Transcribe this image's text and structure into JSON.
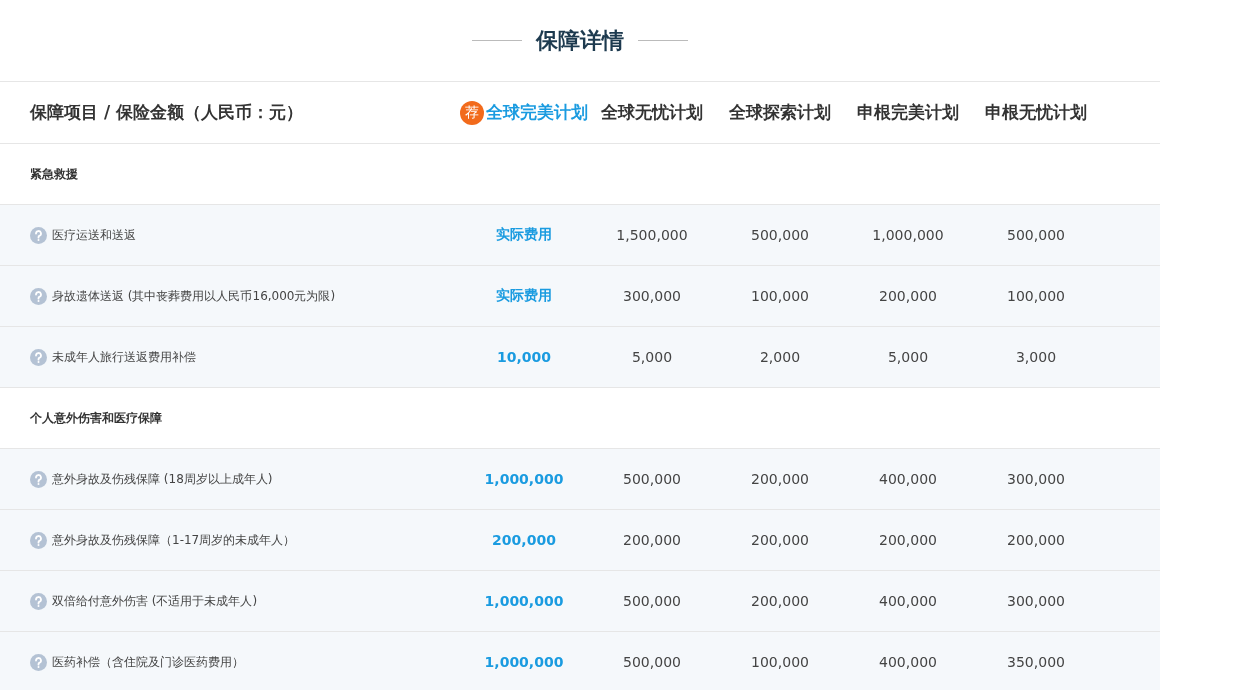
{
  "title": "保障详情",
  "header": {
    "label": "保障项目 / 保险金额（人民币：元）",
    "plans": [
      {
        "name": "全球完美计划",
        "recommended": true,
        "badge": "荐"
      },
      {
        "name": "全球无忧计划",
        "recommended": false
      },
      {
        "name": "全球探索计划",
        "recommended": false
      },
      {
        "name": "申根完美计划",
        "recommended": false
      },
      {
        "name": "申根无忧计划",
        "recommended": false
      }
    ]
  },
  "rows": [
    {
      "kind": "section",
      "label": "紧急救援"
    },
    {
      "kind": "item",
      "label": "医疗运送和送返",
      "values": [
        "实际费用",
        "1,500,000",
        "500,000",
        "1,000,000",
        "500,000"
      ]
    },
    {
      "kind": "item",
      "label": "身故遗体送返 (其中丧葬费用以人民币16,000元为限)",
      "values": [
        "实际费用",
        "300,000",
        "100,000",
        "200,000",
        "100,000"
      ]
    },
    {
      "kind": "item",
      "label": "未成年人旅行送返费用补偿",
      "values": [
        "10,000",
        "5,000",
        "2,000",
        "5,000",
        "3,000"
      ]
    },
    {
      "kind": "section",
      "label": "个人意外伤害和医疗保障"
    },
    {
      "kind": "item",
      "label": "意外身故及伤残保障 (18周岁以上成年人)",
      "values": [
        "1,000,000",
        "500,000",
        "200,000",
        "400,000",
        "300,000"
      ]
    },
    {
      "kind": "item",
      "label": "意外身故及伤残保障（1-17周岁的未成年人）",
      "values": [
        "200,000",
        "200,000",
        "200,000",
        "200,000",
        "200,000"
      ]
    },
    {
      "kind": "item",
      "label": "双倍给付意外伤害 (不适用于未成年人)",
      "values": [
        "1,000,000",
        "500,000",
        "200,000",
        "400,000",
        "300,000"
      ]
    },
    {
      "kind": "item",
      "label": "医药补偿（含住院及门诊医药费用）",
      "values": [
        "1,000,000",
        "500,000",
        "100,000",
        "400,000",
        "350,000"
      ]
    }
  ]
}
